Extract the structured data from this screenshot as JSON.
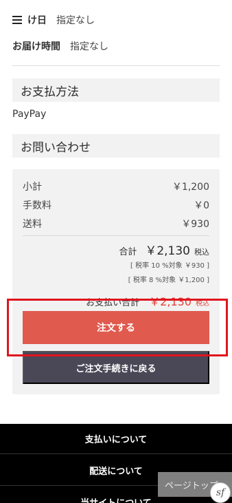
{
  "delivery": {
    "date_label": "け日",
    "date_value": "指定なし",
    "time_label": "お届け時間",
    "time_value": "指定なし"
  },
  "payment": {
    "heading": "お支払方法",
    "value": "PayPay"
  },
  "contact": {
    "heading": "お問い合わせ"
  },
  "summary": {
    "subtotal_label": "小計",
    "subtotal_value": "￥1,200",
    "fee_label": "手数料",
    "fee_value": "￥0",
    "shipping_label": "送料",
    "shipping_value": "￥930",
    "total_label": "合計",
    "total_value": "￥2,130",
    "total_tax": "税込",
    "tax_note_10": "[ 税率 10 %対象 ￥930 ]",
    "tax_note_8": "[ 税率 8 %対象 ￥1,200 ]",
    "grand_label": "お支払い合計",
    "grand_value": "￥2,130",
    "grand_tax": "税込"
  },
  "buttons": {
    "order": "注文する",
    "back": "ご注文手続きに戻る"
  },
  "footer": {
    "items": [
      "支払いについて",
      "配送について",
      "当サイトについて"
    ],
    "page_top": "ページトップ"
  },
  "colors": {
    "accent": "#e05a4e",
    "secondary_button": "#4a4757",
    "highlight_box": "#e0141d"
  }
}
